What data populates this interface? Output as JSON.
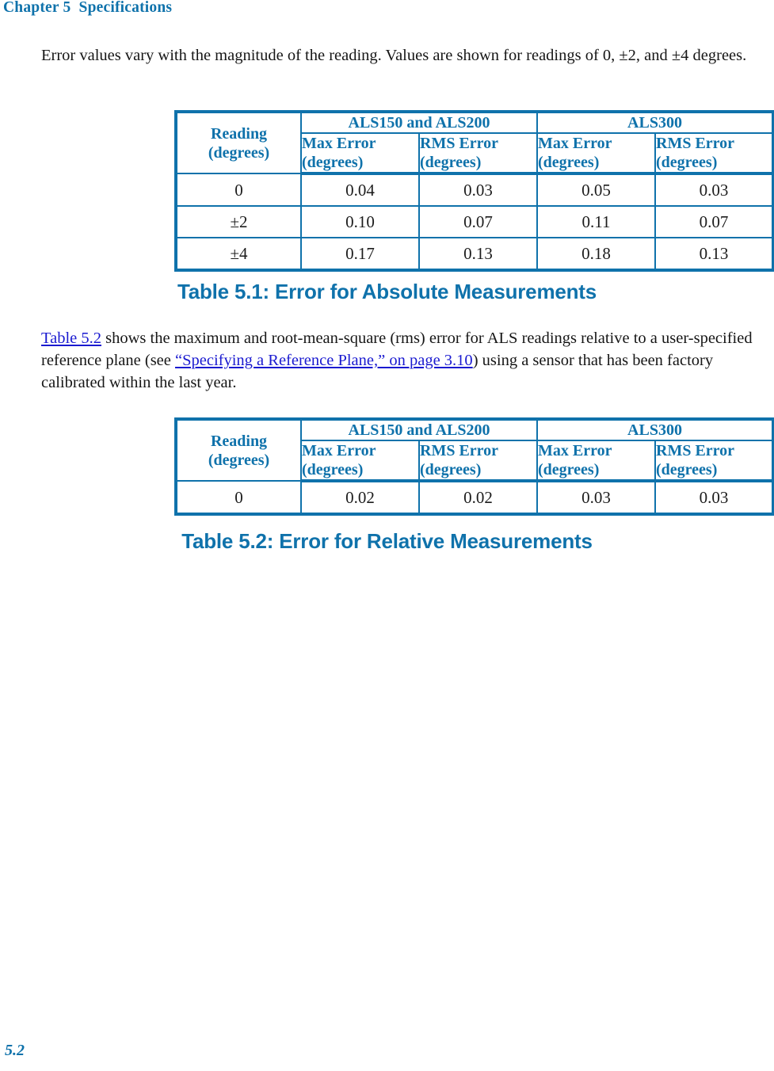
{
  "header": {
    "chapter_label": "Chapter 5  Specifications"
  },
  "intro_paragraph": {
    "text": "Error values vary with the magnitude of the reading. Values are shown for readings of 0, ±2, and ±4 degrees."
  },
  "table_51": {
    "caption": "Table 5.1: Error for Absolute Measurements",
    "header": {
      "reading_line1": "Reading",
      "reading_line2": "(degrees)",
      "group_1": "ALS150 and ALS200",
      "group_2": "ALS300",
      "sub_cols": [
        {
          "line1": "Max Error",
          "line2": "(degrees)"
        },
        {
          "line1": "RMS Error",
          "line2": "(degrees)"
        },
        {
          "line1": "Max Error",
          "line2": "(degrees)"
        },
        {
          "line1": "RMS Error",
          "line2": "(degrees)"
        }
      ]
    },
    "rows": [
      {
        "reading": "0",
        "als150_max": "0.04",
        "als150_rms": "0.03",
        "als300_max": "0.05",
        "als300_rms": "0.03"
      },
      {
        "reading": "±2",
        "als150_max": "0.10",
        "als150_rms": "0.07",
        "als300_max": "0.11",
        "als300_rms": "0.07"
      },
      {
        "reading": "±4",
        "als150_max": "0.17",
        "als150_rms": "0.13",
        "als300_max": "0.18",
        "als300_rms": "0.13"
      }
    ]
  },
  "table52_paragraph": {
    "link_table": "Table 5.2",
    "part1": " shows the maximum and root-mean-square (rms) error for ALS readings relative to a user-specified reference plane (see ",
    "link_reference": "“Specifying a Reference Plane,” on page 3.10",
    "part2": ") using a sensor that has been factory calibrated within the last year."
  },
  "table_52": {
    "caption": "Table 5.2: Error for Relative Measurements",
    "header": {
      "reading_line1": "Reading",
      "reading_line2": "(degrees)",
      "group_1": "ALS150 and ALS200",
      "group_2": "ALS300",
      "sub_cols": [
        {
          "line1": "Max Error",
          "line2": "(degrees)"
        },
        {
          "line1": "RMS Error",
          "line2": "(degrees)"
        },
        {
          "line1": "Max Error",
          "line2": "(degrees)"
        },
        {
          "line1": "RMS Error",
          "line2": "(degrees)"
        }
      ]
    },
    "rows": [
      {
        "reading": "0",
        "als150_max": "0.02",
        "als150_rms": "0.02",
        "als300_max": "0.03",
        "als300_rms": "0.03"
      }
    ]
  },
  "footer": {
    "page_number": "5.2"
  },
  "colors": {
    "brand_blue": "#0f72ab",
    "link_blue": "#1a1ad0",
    "body_text": "#161616"
  }
}
